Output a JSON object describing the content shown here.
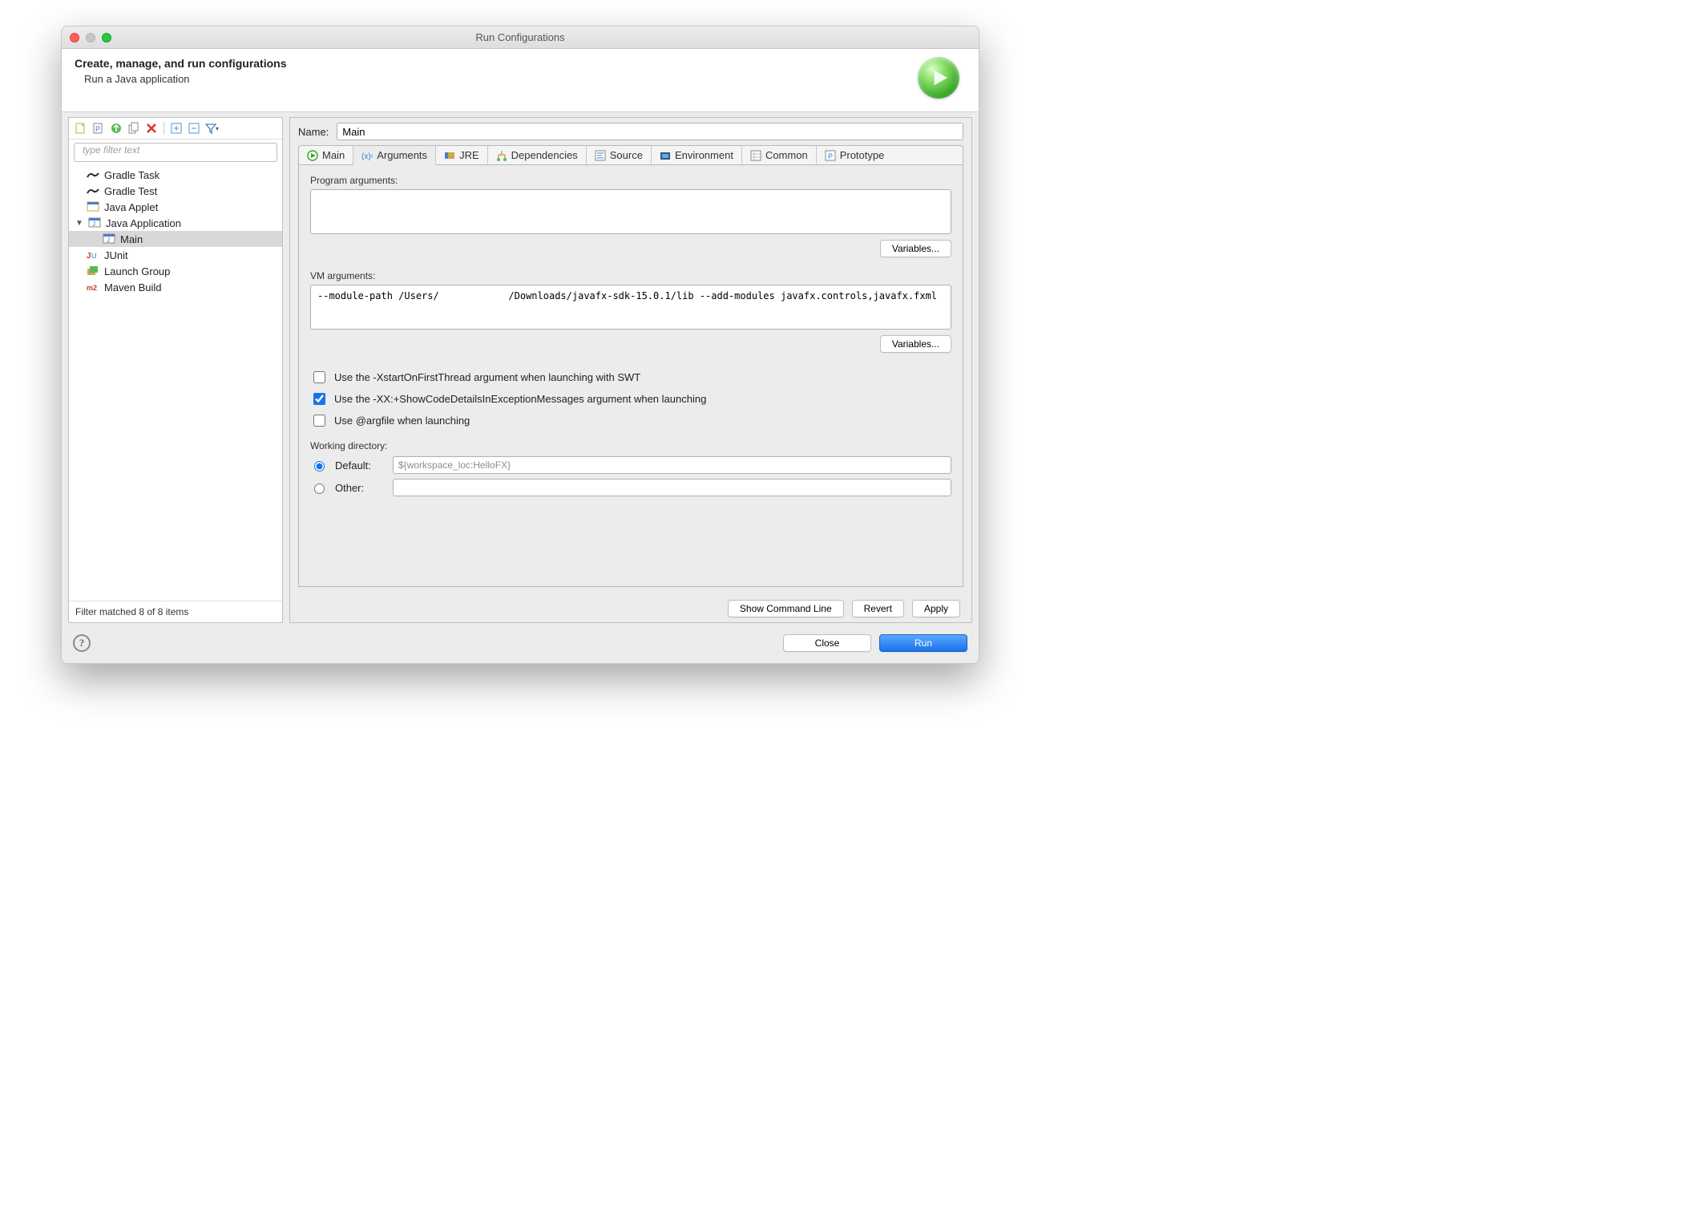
{
  "window": {
    "title": "Run Configurations"
  },
  "header": {
    "title": "Create, manage, and run configurations",
    "subtitle": "Run a Java application"
  },
  "toolbar_icons": [
    "new",
    "new-proto",
    "copy",
    "paste",
    "delete",
    "expand",
    "collapse",
    "filter"
  ],
  "filter": {
    "placeholder": "type filter text"
  },
  "tree": [
    {
      "label": "Gradle Task",
      "icon": "gradle"
    },
    {
      "label": "Gradle Test",
      "icon": "gradle"
    },
    {
      "label": "Java Applet",
      "icon": "applet"
    },
    {
      "label": "Java Application",
      "icon": "java",
      "expandable": true,
      "expanded": true,
      "children": [
        {
          "label": "Main",
          "icon": "java",
          "selected": true
        }
      ]
    },
    {
      "label": "JUnit",
      "icon": "junit"
    },
    {
      "label": "Launch Group",
      "icon": "group"
    },
    {
      "label": "Maven Build",
      "icon": "maven"
    }
  ],
  "status": "Filter matched 8 of 8 items",
  "name": {
    "label": "Name:",
    "value": "Main"
  },
  "tabs": [
    {
      "label": "Main",
      "icon": "run"
    },
    {
      "label": "Arguments",
      "icon": "args",
      "active": true
    },
    {
      "label": "JRE",
      "icon": "jre"
    },
    {
      "label": "Dependencies",
      "icon": "deps"
    },
    {
      "label": "Source",
      "icon": "src"
    },
    {
      "label": "Environment",
      "icon": "env"
    },
    {
      "label": "Common",
      "icon": "common"
    },
    {
      "label": "Prototype",
      "icon": "proto"
    }
  ],
  "arguments": {
    "program_label": "Program arguments:",
    "program_value": "",
    "vm_label": "VM arguments:",
    "vm_value": "--module-path /Users/            /Downloads/javafx-sdk-15.0.1/lib --add-modules javafx.controls,javafx.fxml",
    "variables_label": "Variables...",
    "swt_label": "Use the -XstartOnFirstThread argument when launching with SWT",
    "swt_checked": false,
    "xx_label": "Use the -XX:+ShowCodeDetailsInExceptionMessages argument when launching",
    "xx_checked": true,
    "argfile_label": "Use @argfile when launching",
    "argfile_checked": false,
    "wd_label": "Working directory:",
    "wd_default_label": "Default:",
    "wd_default_value": "${workspace_loc:HelloFX}",
    "wd_other_label": "Other:"
  },
  "actions": {
    "show_cmd": "Show Command Line",
    "revert": "Revert",
    "apply": "Apply"
  },
  "footer": {
    "close": "Close",
    "run": "Run"
  }
}
